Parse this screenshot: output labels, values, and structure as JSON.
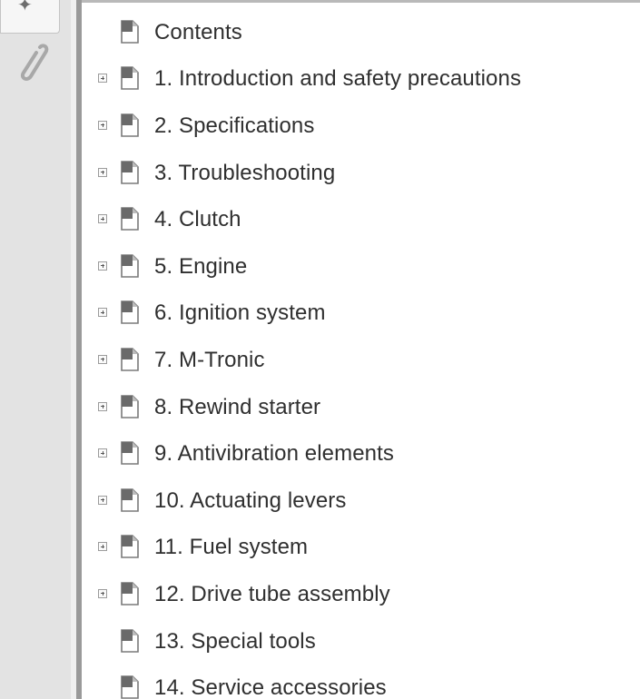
{
  "navigation": {
    "active_tab_icon": "bookmarks-icon",
    "attachments_icon": "paperclip-icon"
  },
  "bookmarks": {
    "items": [
      {
        "label": "Contents",
        "expandable": false
      },
      {
        "label": "1. Introduction and safety precautions",
        "expandable": true
      },
      {
        "label": "2. Specifications",
        "expandable": true
      },
      {
        "label": "3. Troubleshooting",
        "expandable": true
      },
      {
        "label": "4. Clutch",
        "expandable": true
      },
      {
        "label": "5. Engine",
        "expandable": true
      },
      {
        "label": "6. Ignition system",
        "expandable": true
      },
      {
        "label": "7. M-Tronic",
        "expandable": true
      },
      {
        "label": "8. Rewind starter",
        "expandable": true
      },
      {
        "label": "9. Antivibration elements",
        "expandable": true
      },
      {
        "label": "10. Actuating levers",
        "expandable": true
      },
      {
        "label": "11. Fuel system",
        "expandable": true
      },
      {
        "label": "12. Drive tube assembly",
        "expandable": true
      },
      {
        "label": "13. Special tools",
        "expandable": false
      },
      {
        "label": "14. Service accessories",
        "expandable": false
      }
    ]
  },
  "colors": {
    "nav_background": "#e3e3e3",
    "panel_background": "#ffffff",
    "label_text": "#2f2f2f",
    "page_icon_fold": "#6a6a6a"
  }
}
